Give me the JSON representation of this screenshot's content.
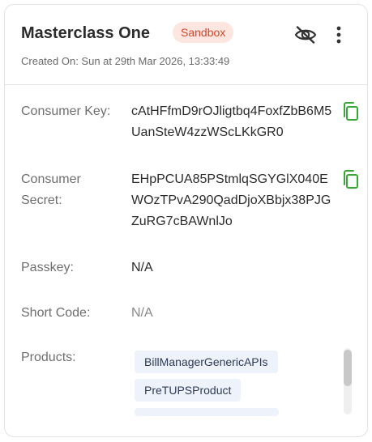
{
  "header": {
    "app_name": "Masterclass One",
    "environment_badge": "Sandbox",
    "created_on": "Created On: Sun at 29th Mar 2026, 13:33:49"
  },
  "fields": {
    "consumer_key": {
      "label": "Consumer Key:",
      "value": "cAtHFfmD9rOJligtbq4FoxfZbB6M5UanSteW4zzWScLKkGR0"
    },
    "consumer_secret": {
      "label": "Consumer Secret:",
      "value": "EHpPCUA85PStmlqSGYGlX040EWOzTPvA290QadDjoXBbjx38PJGZuRG7cBAWnlJo"
    },
    "passkey": {
      "label": "Passkey:",
      "value": "N/A"
    },
    "short_code": {
      "label": "Short Code:",
      "value": "N/A"
    },
    "products": {
      "label": "Products:",
      "items": [
        "BillManagerGenericAPIs",
        "PreTUPSProduct"
      ]
    }
  },
  "colors": {
    "badge_bg": "#fde6df",
    "badge_text": "#d0462c",
    "copy_icon": "#3aa63a",
    "tag_bg": "#eef2fa"
  },
  "icons": {
    "hide": "eye-off-icon",
    "more": "more-vertical-icon",
    "copy": "copy-icon"
  }
}
